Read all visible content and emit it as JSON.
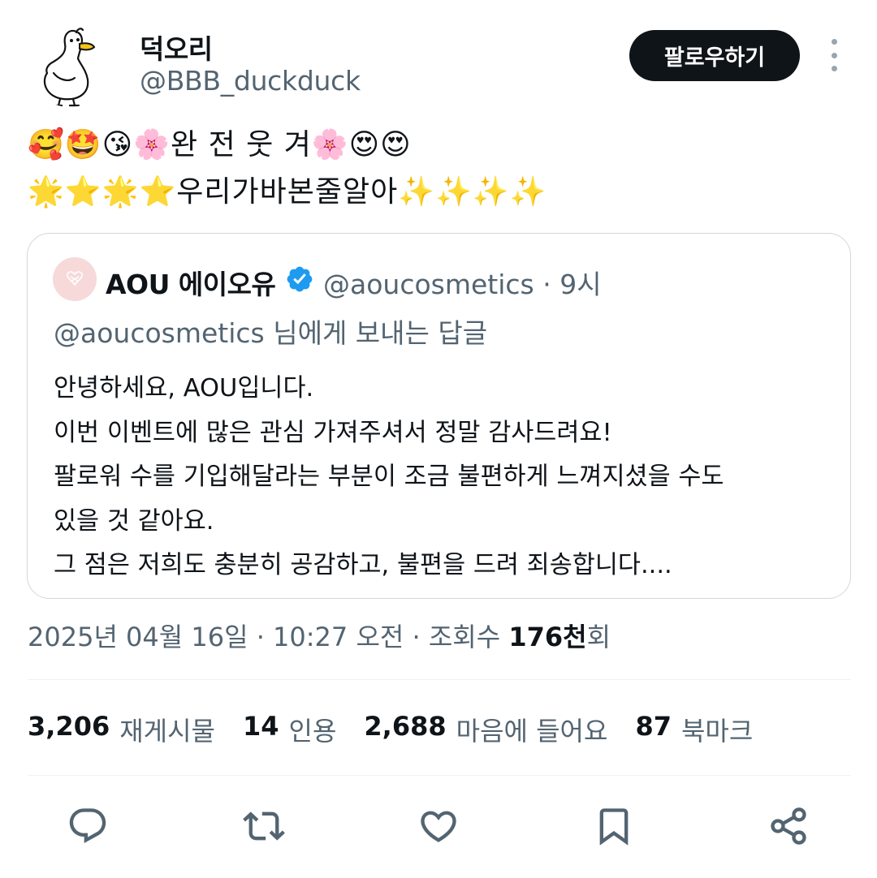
{
  "author": {
    "display_name": "덕오리",
    "handle": "@BBB_duckduck",
    "avatar_icon": "duck-drawing-icon"
  },
  "follow_button": {
    "label": "팔로우하기"
  },
  "tweet": {
    "line1": "🥰🤩😘🌸완 전 웃 겨🌸😍😍",
    "line2": "🌟⭐🌟⭐우리가바본줄알아✨✨✨✨"
  },
  "quote": {
    "name": "AOU 에이오유",
    "handle": "@aoucosmetics · 9시",
    "reply_context": "@aoucosmetics 님에게 보내는 답글",
    "body_lines": [
      "안녕하세요, AOU입니다.",
      "이번 이벤트에 많은 관심 가져주셔서 정말 감사드려요!",
      "팔로워 수를 기입해달라는 부분이 조금 불편하게 느껴지셨을 수도",
      "있을 것 같아요.",
      "그 점은 저희도 충분히 공감하고, 불편을 드려 죄송합니다...."
    ],
    "verified_color": "#1d9bf0"
  },
  "meta": {
    "timestamp": "2025년 04월 16일 · 10:27 오전 · 조회수 ",
    "views_number": "176천",
    "views_suffix": "회"
  },
  "stats": [
    {
      "number": "3,206",
      "label": "재게시물"
    },
    {
      "number": "14",
      "label": "인용"
    },
    {
      "number": "2,688",
      "label": "마음에 들어요"
    },
    {
      "number": "87",
      "label": "북마크"
    }
  ],
  "actions": [
    "reply-icon",
    "retweet-icon",
    "like-icon",
    "bookmark-icon",
    "share-icon"
  ],
  "colors": {
    "text_primary": "#0f1419",
    "text_secondary": "#536471",
    "border": "#cfd9de",
    "follow_bg": "#0f1419"
  }
}
